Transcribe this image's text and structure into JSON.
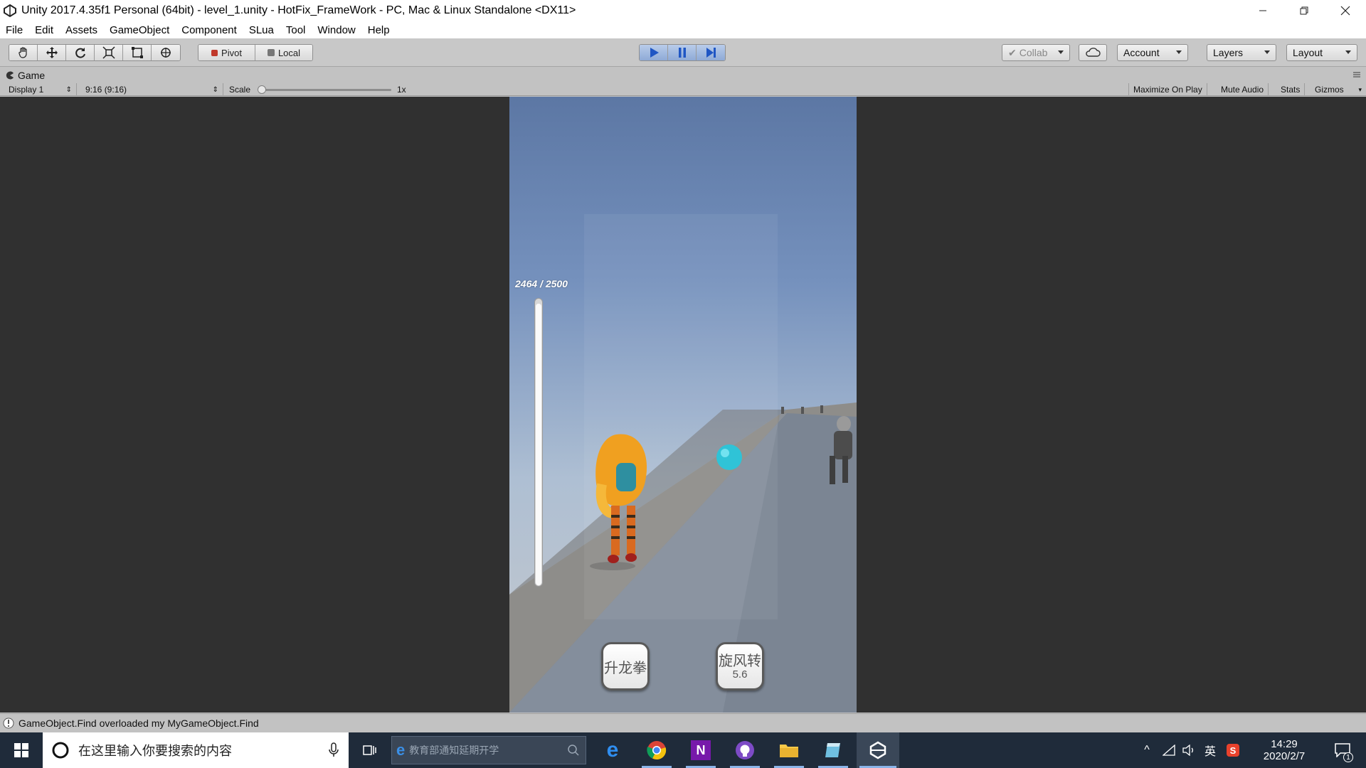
{
  "window": {
    "title": "Unity 2017.4.35f1 Personal (64bit) - level_1.unity - HotFix_FrameWork - PC, Mac & Linux Standalone <DX11>",
    "minimize_icon": "minimize-icon",
    "restore_icon": "restore-icon",
    "close_icon": "close-icon"
  },
  "menubar": {
    "items": [
      "File",
      "Edit",
      "Assets",
      "GameObject",
      "Component",
      "SLua",
      "Tool",
      "Window",
      "Help"
    ]
  },
  "toolbar": {
    "tools": [
      "hand-icon",
      "move-icon",
      "rotate-icon",
      "scale-icon",
      "rect-icon",
      "transform-icon"
    ],
    "pivot_label": "Pivot",
    "local_label": "Local",
    "collab_label": "Collab",
    "account_label": "Account",
    "layers_label": "Layers",
    "layout_label": "Layout",
    "play_active_color": "#3b6fc7"
  },
  "game_view": {
    "tab_label": "Game",
    "display": "Display 1",
    "aspect": "9:16 (9:16)",
    "scale_label": "Scale",
    "scale_value": "1x",
    "maximize_on_play": "Maximize On Play",
    "mute_audio": "Mute Audio",
    "stats": "Stats",
    "gizmos": "Gizmos"
  },
  "game_hud": {
    "hp_text": "2464 / 2500",
    "hp_fraction": 0.9856,
    "skill_1": "升龙拳",
    "skill_2": "旋风转",
    "skill_2_cooldown": "5.6"
  },
  "status": {
    "message": "GameObject.Find overloaded my MyGameObject.Find"
  },
  "taskbar": {
    "search_placeholder": "在这里输入你要搜索的内容",
    "ie_search_placeholder": "教育部通知延期开学",
    "input_lang": "英",
    "time": "14:29",
    "date": "2020/2/7",
    "notification_count": "1"
  }
}
